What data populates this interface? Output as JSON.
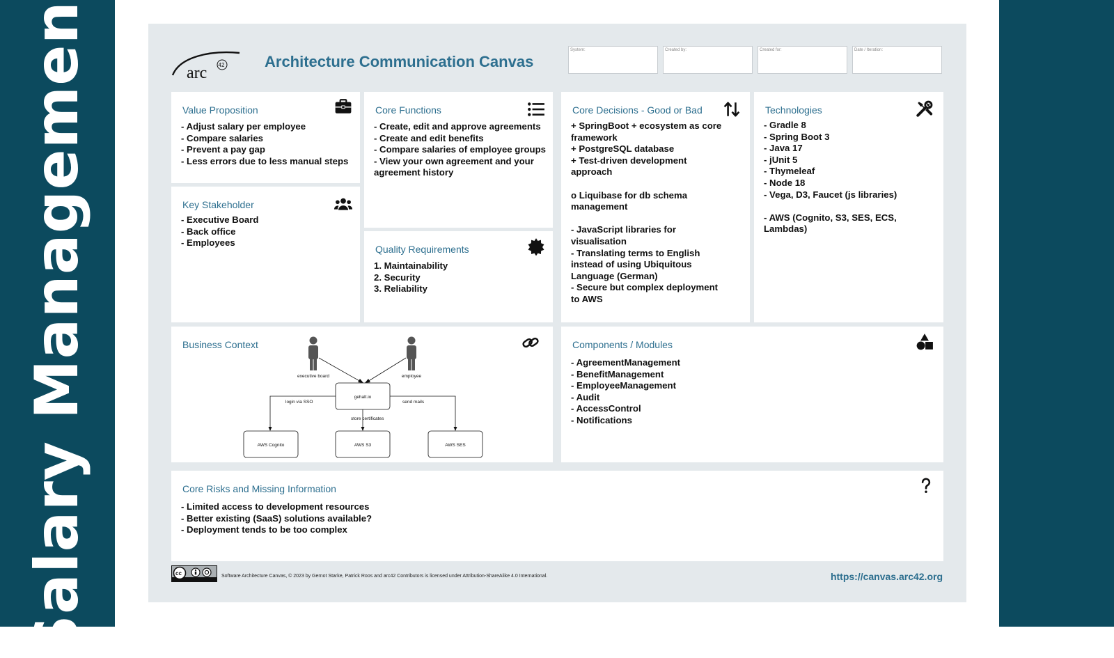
{
  "side_title": "Salary Management",
  "canvas_title": "Architecture Communication Canvas",
  "logo": {
    "text": "arc",
    "superscript": "42"
  },
  "meta_fields": [
    "System:",
    "Created by:",
    "Created for:",
    "Date / Iteration:"
  ],
  "value_proposition": {
    "title": "Value Proposition",
    "icon": "briefcase-icon",
    "items": [
      "- Adjust salary per employee",
      "- Compare salaries",
      "- Prevent a pay gap",
      "- Less errors due to less manual steps"
    ]
  },
  "key_stakeholder": {
    "title": "Key Stakeholder",
    "icon": "users-icon",
    "items": [
      "- Executive Board",
      "- Back office",
      "- Employees"
    ]
  },
  "core_functions": {
    "title": "Core Functions",
    "icon": "list-icon",
    "items": [
      "- Create, edit and approve agreements",
      "- Create and edit benefits",
      "- Compare salaries of employee groups",
      "- View your own agreement and your",
      "agreement history"
    ]
  },
  "quality_requirements": {
    "title": "Quality Requirements",
    "icon": "badge-icon",
    "items": [
      "1. Maintainability",
      "2. Security",
      "3. Reliability"
    ]
  },
  "core_decisions": {
    "title": "Core Decisions - Good or Bad",
    "icon": "up-down-arrows-icon",
    "items": [
      "+ SpringBoot + ecosystem as core",
      "framework",
      "+ PostgreSQL database",
      "+ Test-driven development",
      "approach",
      "",
      "o Liquibase for db schema",
      "management",
      "",
      "- JavaScript libraries for",
      "visualisation",
      "- Translating terms to English",
      "instead of using Ubiquitous",
      "Language (German)",
      "- Secure but complex deployment",
      "to AWS"
    ]
  },
  "technologies": {
    "title": "Technologies",
    "icon": "tools-icon",
    "items": [
      "- Gradle 8",
      "- Spring Boot 3",
      "- Java 17",
      "- jUnit 5",
      "- Thymeleaf",
      "- Node 18",
      "- Vega, D3, Faucet (js libraries)",
      "",
      "- AWS (Cognito, S3, SES, ECS,",
      "Lambdas)"
    ]
  },
  "business_context": {
    "title": "Business Context",
    "icon": "link-icon",
    "diagram": {
      "actor_left": "executive board",
      "actor_right": "employee",
      "center": "gehalt.io",
      "edge_left": "login via SSO",
      "edge_mid": "store certificates",
      "edge_right": "send mails",
      "box_left": "AWS Cognito",
      "box_mid": "AWS S3",
      "box_right": "AWS SES"
    }
  },
  "components": {
    "title": "Components / Modules",
    "icon": "shapes-icon",
    "items": [
      "- AgreementManagement",
      "- BenefitManagement",
      "- EmployeeManagement",
      "- Audit",
      "- AccessControl",
      "- Notifications"
    ]
  },
  "core_risks": {
    "title": "Core Risks and Missing Information",
    "icon": "question-icon",
    "items": [
      "- Limited access to development resources",
      "- Better existing (SaaS) solutions available?",
      "- Deployment tends to be too complex"
    ]
  },
  "footer": {
    "license_badge": "cc-by-sa-icon",
    "license_text": "Software Architecture Canvas, © 2023 by Gernot Starke, Patrick Roos and arc42 Contributors is licensed under Attribution-ShareAlike 4.0 International.",
    "link": "https://canvas.arc42.org"
  }
}
